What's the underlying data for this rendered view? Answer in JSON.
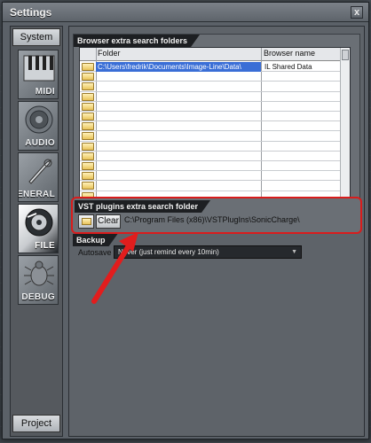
{
  "window": {
    "title": "Settings",
    "close_label": "x"
  },
  "sidebar": {
    "top_button": "System",
    "bottom_button": "Project",
    "categories": [
      {
        "label": "MIDI",
        "icon": "piano-keys-icon"
      },
      {
        "label": "AUDIO",
        "icon": "speaker-icon"
      },
      {
        "label": "GENERAL",
        "icon": "wrench-icon"
      },
      {
        "label": "FILE",
        "icon": "disk-icon",
        "active": true
      },
      {
        "label": "DEBUG",
        "icon": "bug-icon"
      }
    ]
  },
  "browser_folders": {
    "section_title": "Browser extra search folders",
    "columns": [
      "Folder",
      "Browser name"
    ],
    "rows": [
      {
        "folder": "C:\\Users\\fredrik\\Documents\\Image-Line\\Data\\",
        "name": "IL Shared Data",
        "selected": true
      },
      {
        "folder": "",
        "name": ""
      },
      {
        "folder": "",
        "name": ""
      },
      {
        "folder": "",
        "name": ""
      },
      {
        "folder": "",
        "name": ""
      },
      {
        "folder": "",
        "name": ""
      },
      {
        "folder": "",
        "name": ""
      },
      {
        "folder": "",
        "name": ""
      },
      {
        "folder": "",
        "name": ""
      },
      {
        "folder": "",
        "name": ""
      },
      {
        "folder": "",
        "name": ""
      },
      {
        "folder": "",
        "name": ""
      },
      {
        "folder": "",
        "name": ""
      },
      {
        "folder": "",
        "name": ""
      },
      {
        "folder": "",
        "name": ""
      }
    ]
  },
  "vst": {
    "section_title": "VST plugins extra search folder",
    "clear_label": "Clear",
    "path": "C:\\Program Files (x86)\\VSTPlugIns\\SonicCharge\\"
  },
  "backup": {
    "section_title": "Backup",
    "autosave_label": "Autosave",
    "autosave_value": "Never (just remind every 10min)"
  },
  "annotation": {
    "highlight_color": "#d91c1c"
  }
}
